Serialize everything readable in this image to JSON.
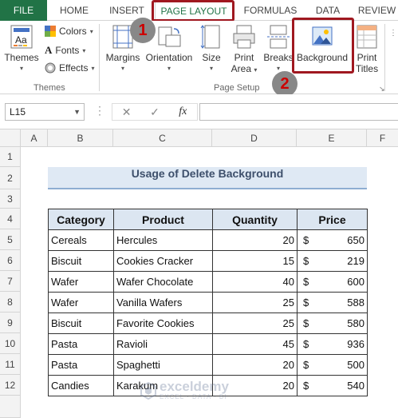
{
  "ribbon_tabs": [
    "FILE",
    "HOME",
    "INSERT",
    "PAGE LAYOUT",
    "FORMULAS",
    "DATA",
    "REVIEW"
  ],
  "active_tab": "PAGE LAYOUT",
  "annotations": {
    "step1": "1",
    "step2": "2",
    "highlight_color": "#a01820"
  },
  "themes_group": {
    "themes_label": "Themes",
    "colors_label": "Colors",
    "fonts_label": "Fonts",
    "effects_label": "Effects",
    "group_label": "Themes"
  },
  "page_setup_group": {
    "margins_label": "Margins",
    "orientation_label": "Orientation",
    "size_label": "Size",
    "print_area_label_1": "Print",
    "print_area_label_2": "Area",
    "breaks_label": "Breaks",
    "background_label": "Background",
    "print_titles_label_1": "Print",
    "print_titles_label_2": "Titles",
    "group_label": "Page Setup"
  },
  "formula_bar": {
    "name_box": "L15",
    "cancel_icon": "✕",
    "enter_icon": "✓",
    "fx_label": "fx",
    "formula": ""
  },
  "columns": [
    "A",
    "B",
    "C",
    "D",
    "E",
    "F"
  ],
  "rows": [
    "1",
    "2",
    "3",
    "4",
    "5",
    "6",
    "7",
    "8",
    "9",
    "10",
    "11",
    "12"
  ],
  "sheet": {
    "title": "Usage of Delete Background",
    "headers": [
      "Category",
      "Product",
      "Quantity",
      "Price"
    ],
    "currency_symbol": "$",
    "records": [
      {
        "category": "Cereals",
        "product": "Hercules",
        "quantity": "20",
        "price": "650"
      },
      {
        "category": "Biscuit",
        "product": "Cookies Cracker",
        "quantity": "15",
        "price": "219"
      },
      {
        "category": "Wafer",
        "product": "Wafer Chocolate",
        "quantity": "40",
        "price": "600"
      },
      {
        "category": "Wafer",
        "product": "Vanilla Wafers",
        "quantity": "25",
        "price": "588"
      },
      {
        "category": "Biscuit",
        "product": "Favorite Cookies",
        "quantity": "25",
        "price": "580"
      },
      {
        "category": "Pasta",
        "product": "Ravioli",
        "quantity": "45",
        "price": "936"
      },
      {
        "category": "Pasta",
        "product": "Spaghetti",
        "quantity": "20",
        "price": "500"
      },
      {
        "category": "Candies",
        "product": "Karakum",
        "quantity": "20",
        "price": "540"
      }
    ]
  },
  "watermark": {
    "name": "exceldemy",
    "tagline": "EXCEL · DATA · BI"
  },
  "colors": {
    "excel_green": "#217346",
    "header_fill": "#dce6f1",
    "title_fill": "#dfe9f4"
  }
}
